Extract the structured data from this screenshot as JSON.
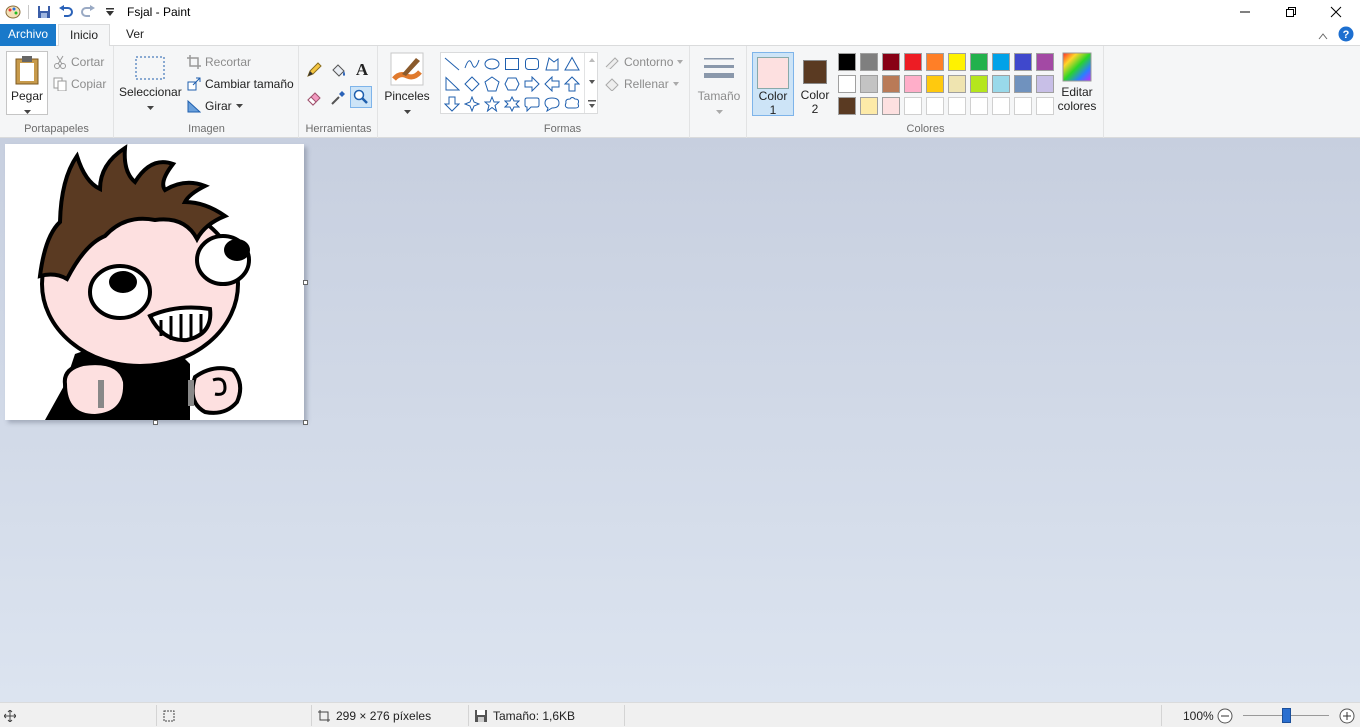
{
  "window": {
    "title": "Fsjal - Paint"
  },
  "tabs": {
    "file": "Archivo",
    "home": "Inicio",
    "view": "Ver"
  },
  "clipboard": {
    "paste": "Pegar",
    "cut": "Cortar",
    "copy": "Copiar",
    "label": "Portapapeles"
  },
  "image": {
    "select": "Seleccionar",
    "crop": "Recortar",
    "resize": "Cambiar tamaño",
    "rotate": "Girar",
    "label": "Imagen"
  },
  "tools": {
    "label": "Herramientas",
    "text_tool": "A"
  },
  "brushes": {
    "label": "Pinceles"
  },
  "shapes": {
    "outline": "Contorno",
    "fill": "Rellenar",
    "label": "Formas"
  },
  "size": {
    "label": "Tamaño"
  },
  "colors": {
    "color1_line1": "Color",
    "color1_line2": "1",
    "color2_line1": "Color",
    "color2_line2": "2",
    "edit_line1": "Editar",
    "edit_line2": "colores",
    "label": "Colores",
    "color1_value": "#fde0e0",
    "color2_value": "#5a3a22",
    "palette": [
      "#000000",
      "#7f7f7f",
      "#880015",
      "#ed1c24",
      "#ff7f27",
      "#fff200",
      "#22b14c",
      "#00a2e8",
      "#3f48cc",
      "#a349a4",
      "#ffffff",
      "#c3c3c3",
      "#b97a57",
      "#ffaec9",
      "#ffc90e",
      "#efe4b0",
      "#b5e61d",
      "#99d9ea",
      "#7092be",
      "#c8bfe7",
      "#5a3a22",
      "#fdeaa8",
      "#fde0e0",
      "#ffffff",
      "#ffffff",
      "#ffffff",
      "#ffffff",
      "#ffffff",
      "#ffffff",
      "#ffffff"
    ]
  },
  "status": {
    "dimensions": "299 × 276 píxeles",
    "filesize": "Tamaño: 1,6KB",
    "zoom": "100%",
    "zoom_level_percent": 100
  }
}
